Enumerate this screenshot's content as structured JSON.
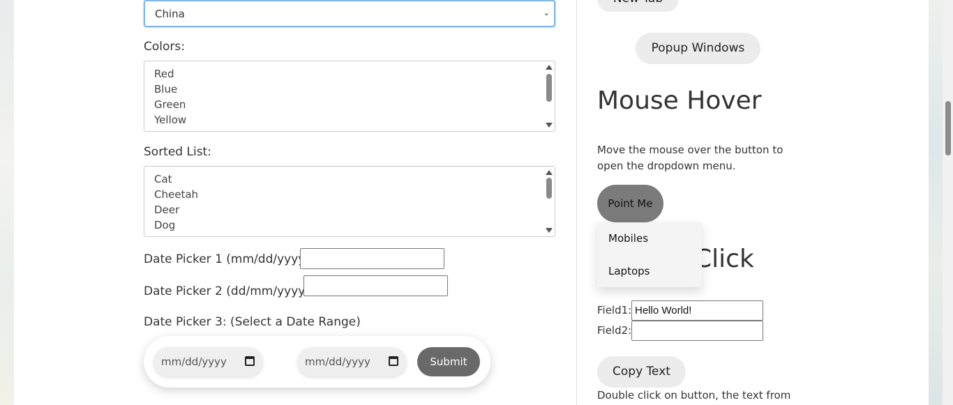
{
  "left": {
    "country_select_value": "China",
    "colors_label": "Colors:",
    "colors_options": [
      "Red",
      "Blue",
      "Green",
      "Yellow"
    ],
    "sorted_label": "Sorted List:",
    "sorted_options": [
      "Cat",
      "Cheetah",
      "Deer",
      "Dog"
    ],
    "date_picker_1_label": "Date Picker 1 (mm/dd/yyyy):",
    "date_picker_2_label": "Date Picker 2 (dd/mm/yyyy) :",
    "date_picker_3_label": "Date Picker 3: (Select a Date Range)",
    "range_start_placeholder": "mm/dd/yyyy",
    "range_end_placeholder": "mm/dd/yyyy",
    "submit_label": "Submit"
  },
  "right": {
    "new_tab_label": "New Tab",
    "popup_label": "Popup Windows",
    "mouse_hover_heading": "Mouse Hover",
    "mouse_hover_text": "Move the mouse over the button to open the dropdown menu.",
    "point_me_label": "Point Me",
    "dropdown_items": [
      "Mobiles",
      "Laptops"
    ],
    "double_click_heading": "Double Click",
    "field1_label": "Field1:",
    "field1_value": "Hello World!",
    "field2_label": "Field2:",
    "field2_value": "",
    "copy_text_label": "Copy Text",
    "double_click_text": "Double click on button, the text from"
  }
}
